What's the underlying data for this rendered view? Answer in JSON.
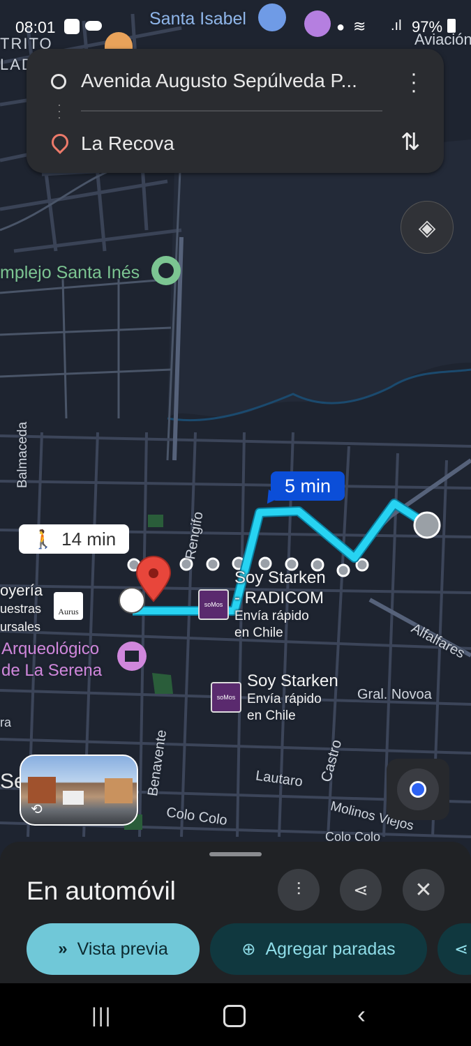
{
  "status_bar": {
    "time": "08:01",
    "battery": "97%",
    "icons": [
      "phone-call-icon",
      "cloud-icon",
      "alarm-icon",
      "no-sim-icon",
      "location-icon",
      "wifi-icon",
      "wifi-call-icon",
      "signal-icon",
      "battery-icon"
    ]
  },
  "route": {
    "origin": "Avenida Augusto Sepúlveda P...",
    "destination": "La Recova"
  },
  "map": {
    "labels": {
      "santa_isabel": "Santa Isabel",
      "aviation": "Aviación",
      "distrito": "TRITO",
      "lado": "LAD",
      "complejo": "mplejo Santa Inés",
      "balmaceda": "Balmaceda",
      "rengifo": "Rengifo",
      "alfalfares": "Alfalfares",
      "gral_novoa": "Gral. Novoa",
      "benavente": "Benavente",
      "castro": "Castro",
      "lautaro": "Lautaro",
      "colo_colo": "Colo Colo",
      "colo_colo_2": "Colo Colo",
      "molinos_viejos": "Molinos Viejos",
      "se": "Se",
      "ra": "ra"
    },
    "museum": [
      "Arqueológico",
      "de La Serena"
    ],
    "joyeria": [
      "oyería",
      "uestras",
      "ursales"
    ],
    "aurus_logo": "Aurus",
    "starken1": {
      "title": [
        "Soy Starken",
        "- RADICOM"
      ],
      "sub": [
        "Envía rápido",
        "en Chile"
      ]
    },
    "starken2": {
      "title": "Soy Starken",
      "sub": [
        "Envía rápido",
        "en Chile"
      ]
    },
    "somos_logo": "soMos",
    "drive_time": "5 min",
    "walk_time": "14 min"
  },
  "sheet": {
    "title": "En automóvil",
    "preview_label": "Vista previa",
    "add_stops_label": "Agregar paradas"
  },
  "colors": {
    "route": "#27d3f2",
    "drive_badge": "#0b4ed8",
    "pin": "#e8463b",
    "preview_bg": "#70c8d8",
    "stops_bg": "#10383f",
    "location_dot": "#2d62f2"
  }
}
